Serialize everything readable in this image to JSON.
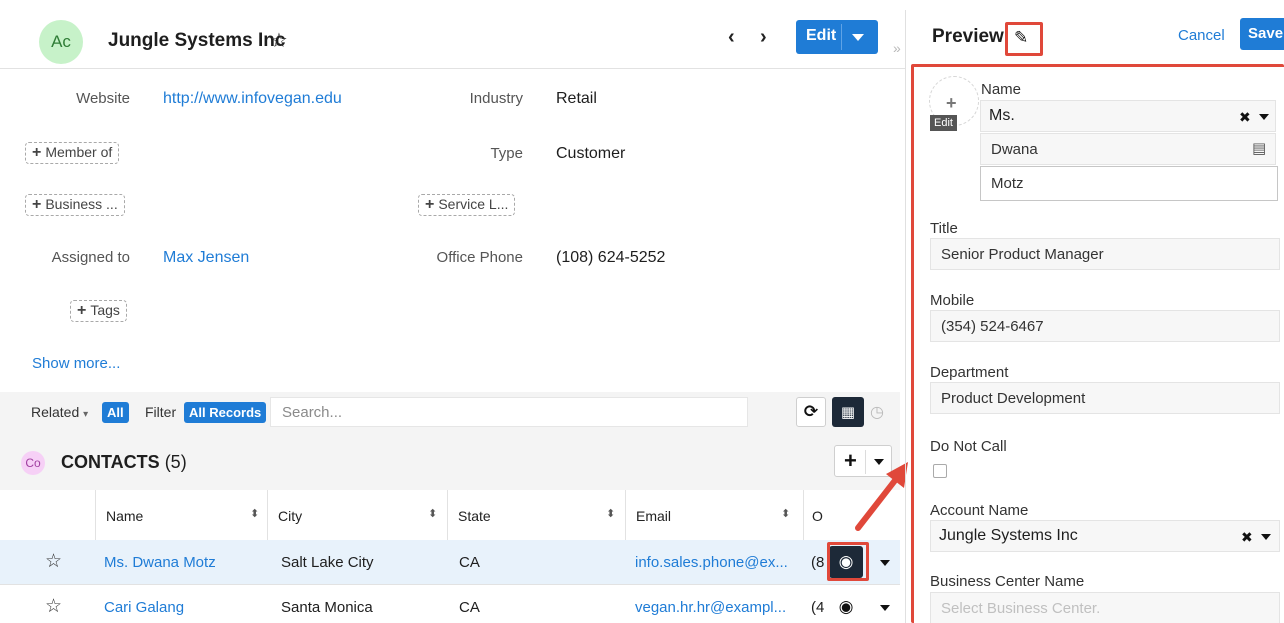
{
  "record": {
    "avatar_initials": "Ac",
    "title": "Jungle Systems Inc",
    "edit_label": "Edit"
  },
  "fields": {
    "website_label": "Website",
    "website_value": "http://www.infovegan.edu",
    "industry_label": "Industry",
    "industry_value": "Retail",
    "member_of_label": "Member of",
    "type_label": "Type",
    "type_value": "Customer",
    "business_label": "Business ...",
    "service_label": "Service L...",
    "assigned_label": "Assigned to",
    "assigned_value": "Max Jensen",
    "phone_label": "Office Phone",
    "phone_value": "(108) 624-5252",
    "tags_label": "Tags",
    "show_more": "Show more..."
  },
  "related_bar": {
    "related_label": "Related",
    "all_label": "All",
    "filter_label": "Filter",
    "all_records_label": "All Records",
    "search_placeholder": "Search..."
  },
  "subpanel": {
    "avatar_initials": "Co",
    "title": "CONTACTS",
    "count": "(5)",
    "columns": [
      "Name",
      "City",
      "State",
      "Email",
      "O"
    ],
    "rows": [
      {
        "name": "Ms. Dwana Motz",
        "city": "Salt Lake City",
        "state": "CA",
        "email": "info.sales.phone@ex...",
        "phone": "(8",
        "selected": true
      },
      {
        "name": "Cari Galang",
        "city": "Santa Monica",
        "state": "CA",
        "email": "vegan.hr.hr@exampl...",
        "phone": "(4",
        "selected": false
      }
    ]
  },
  "preview": {
    "title": "Preview",
    "cancel_label": "Cancel",
    "save_label": "Save",
    "photo_edit_label": "Edit",
    "name_label": "Name",
    "salutation": "Ms.",
    "first_name": "Dwana",
    "last_name": "Motz",
    "title_label": "Title",
    "title_value": "Senior Product Manager",
    "mobile_label": "Mobile",
    "mobile_value": "(354) 524-6467",
    "department_label": "Department",
    "department_value": "Product Development",
    "do_not_call_label": "Do Not Call",
    "account_name_label": "Account Name",
    "account_name_value": "Jungle Systems Inc",
    "business_center_label": "Business Center Name",
    "business_center_placeholder": "Select Business Center."
  },
  "colors": {
    "accent": "#1f7cd6",
    "highlight": "#e0483a",
    "selected_row": "#e8f2fb"
  },
  "icons": [
    "star-icon",
    "chevron-left-icon",
    "chevron-right-icon",
    "refresh-icon",
    "grid-icon",
    "clock-icon",
    "plus-icon",
    "eye-icon",
    "pencil-icon",
    "remove-icon",
    "vcard-icon",
    "sort-icon",
    "caret-down-icon"
  ]
}
